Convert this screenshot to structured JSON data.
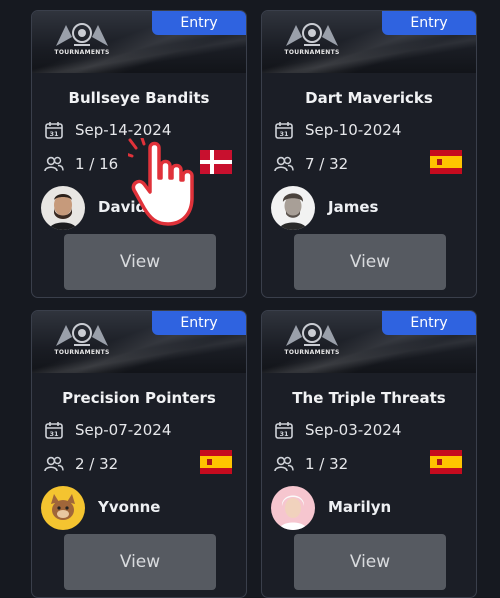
{
  "banner": {
    "logo_text": "TOURNAMENTS"
  },
  "cards": [
    {
      "entry_label": "Entry",
      "title": "Bullseye Bandits",
      "date": "Sep-14-2024",
      "players": "1 / 16",
      "flag_icon": "denmark-flag-icon",
      "username": "David",
      "view_label": "View"
    },
    {
      "entry_label": "Entry",
      "title": "Dart Mavericks",
      "date": "Sep-10-2024",
      "players": "7 / 32",
      "flag_icon": "spain-flag-icon",
      "username": "James",
      "view_label": "View"
    },
    {
      "entry_label": "Entry",
      "title": "Precision Pointers",
      "date": "Sep-07-2024",
      "players": "2 / 32",
      "flag_icon": "spain-flag-icon",
      "username": "Yvonne",
      "view_label": "View"
    },
    {
      "entry_label": "Entry",
      "title": "The Triple Threats",
      "date": "Sep-03-2024",
      "players": "1 / 32",
      "flag_icon": "spain-flag-icon",
      "username": "Marilyn",
      "view_label": "View"
    }
  ],
  "colors": {
    "background": "#161920",
    "card": "#1b1e26",
    "card_border": "#3a3f4b",
    "entry_badge": "#2f63e0",
    "view_button": "#565a61"
  },
  "overlay": {
    "icon": "tap-hand-pointer-icon"
  }
}
